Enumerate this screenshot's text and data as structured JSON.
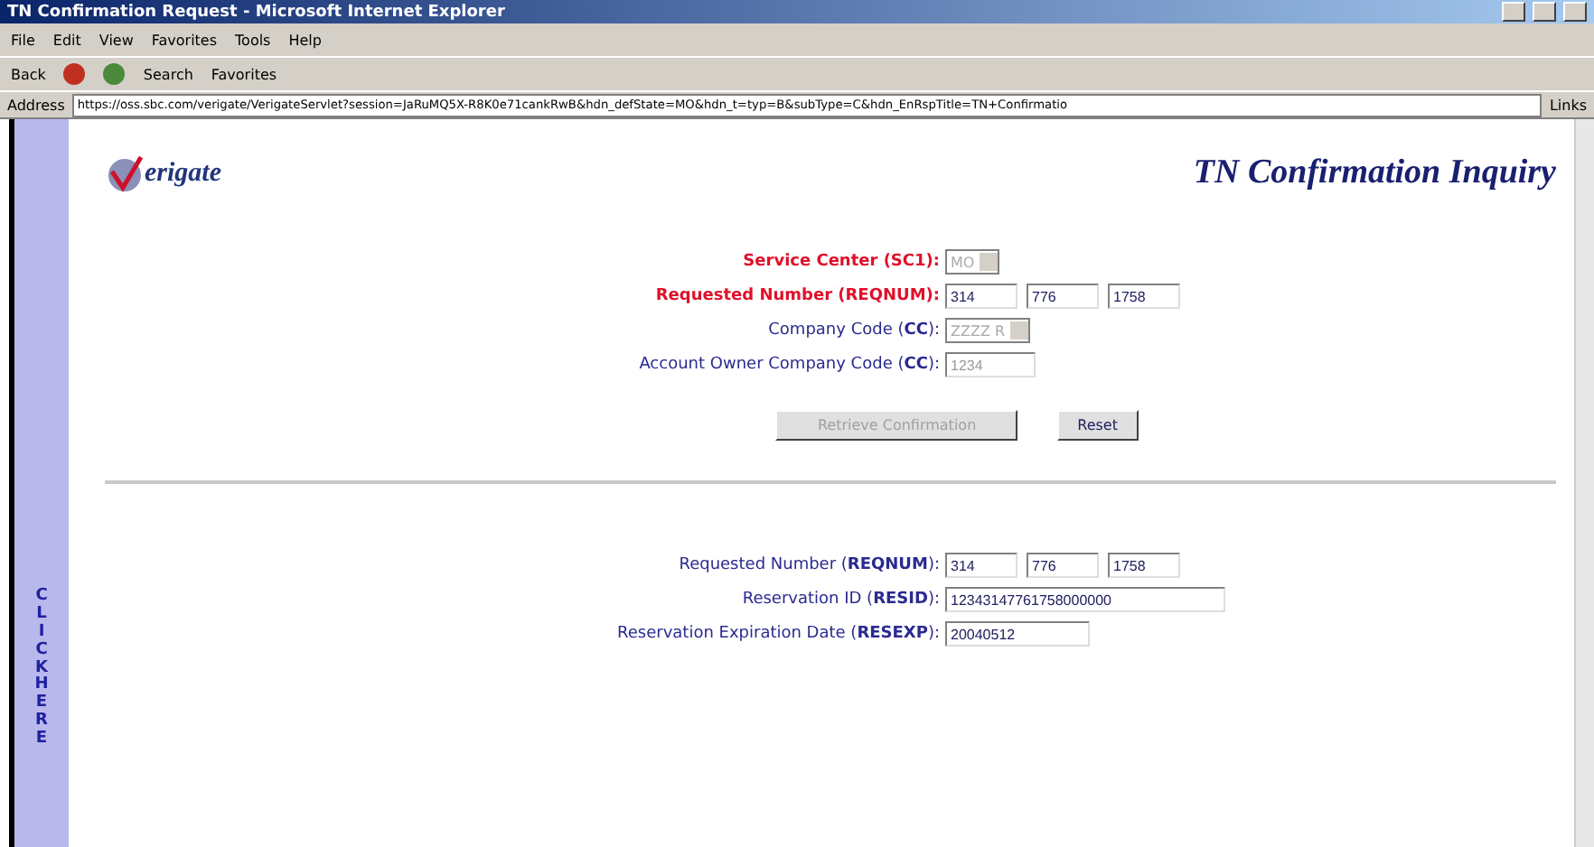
{
  "window": {
    "title": "TN Confirmation Request - Microsoft Internet Explorer"
  },
  "menu": [
    "File",
    "Edit",
    "View",
    "Favorites",
    "Tools",
    "Help"
  ],
  "toolbar": {
    "back": "Back",
    "search": "Search",
    "favorites": "Favorites"
  },
  "address": {
    "label": "Address",
    "url": "https://oss.sbc.com/verigate/VerigateServlet?session=JaRuMQ5X-R8K0e71cankRwB&hdn_defState=MO&hdn_t=typ=B&subType=C&hdn_EnRspTitle=TN+Confirmatio",
    "links": "Links"
  },
  "side_tab": "CLICK HERE",
  "logo": "erigate",
  "heading": "TN Confirmation Inquiry",
  "form": [
    {
      "label": "Service Center (SC1):",
      "required": true,
      "fields": [
        {
          "kind": "select",
          "value": "MO",
          "disabled": true
        }
      ]
    },
    {
      "label": "Requested Number (REQNUM):",
      "required": true,
      "fields": [
        {
          "kind": "text",
          "value": "314",
          "disabled": false
        },
        {
          "kind": "text",
          "value": "776",
          "disabled": false
        },
        {
          "kind": "text",
          "value": "1758",
          "disabled": false
        }
      ]
    },
    {
      "label": "Company Code (**CC**):",
      "required": false,
      "fields": [
        {
          "kind": "select",
          "value": "ZZZZ R",
          "disabled": true
        }
      ]
    },
    {
      "label": "Account Owner Company Code (**CC**):",
      "required": false,
      "fields": [
        {
          "kind": "text",
          "value": "1234",
          "disabled": true
        }
      ]
    }
  ],
  "buttons": [
    {
      "label": "Retrieve Confirmation",
      "disabled": true
    },
    {
      "label": "Reset",
      "disabled": false
    }
  ],
  "results": [
    {
      "label": "Requested Number (**REQNUM**):",
      "fields": [
        "314",
        "776",
        "1758"
      ]
    },
    {
      "label": "Reservation ID (**RESID**):",
      "fields": [
        "12343147761758000000"
      ]
    },
    {
      "label": "Reservation Expiration Date (**RESEXP**):",
      "fields": [
        "20040512"
      ]
    }
  ]
}
